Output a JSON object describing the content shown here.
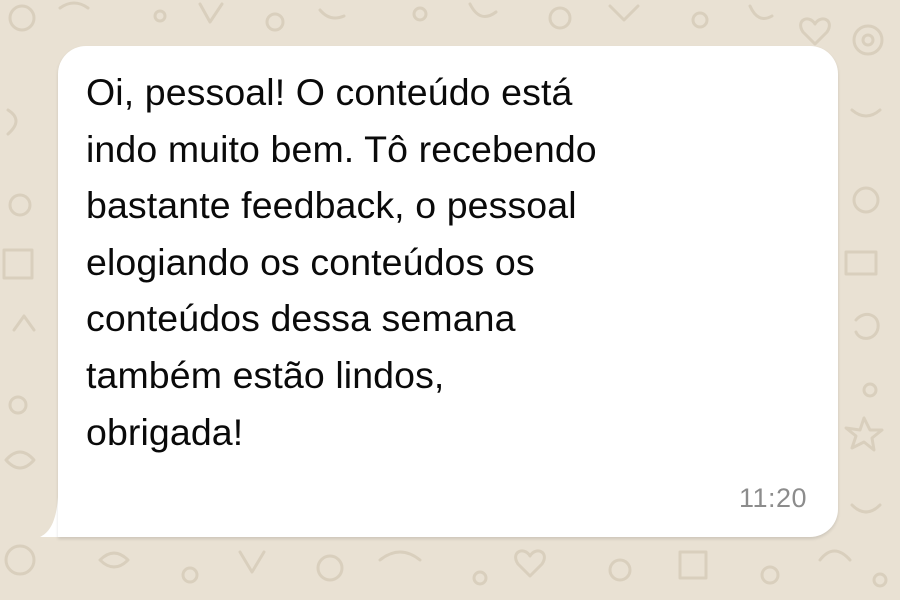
{
  "chat": {
    "background_color": "#e9e1d3",
    "doodle_color": "#d9cfbd",
    "bubble_color": "#ffffff",
    "message": {
      "lines": [
        "Oi, pessoal! O conteúdo está",
        "indo muito bem. Tô recebendo",
        "bastante feedback, o pessoal",
        "elogiando os conteúdos os",
        "conteúdos dessa semana",
        "também estão lindos,",
        "obrigada!"
      ],
      "time": "11:20",
      "text_color": "#0a0a0a",
      "time_color": "#8c8c8c"
    }
  }
}
